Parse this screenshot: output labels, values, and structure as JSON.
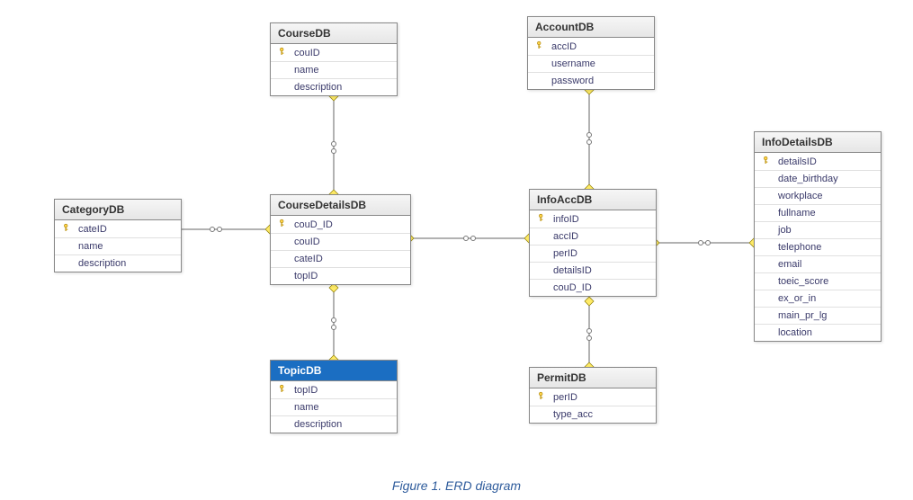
{
  "caption": "Figure 1. ERD diagram",
  "entities": [
    {
      "id": "CategoryDB",
      "title": "CategoryDB",
      "columns": [
        {
          "name": "cateID",
          "pk": true
        },
        {
          "name": "name"
        },
        {
          "name": "description"
        }
      ]
    },
    {
      "id": "CourseDB",
      "title": "CourseDB",
      "columns": [
        {
          "name": "couID",
          "pk": true
        },
        {
          "name": "name"
        },
        {
          "name": "description"
        }
      ]
    },
    {
      "id": "CourseDetailsDB",
      "title": "CourseDetailsDB",
      "columns": [
        {
          "name": "couD_ID",
          "pk": true
        },
        {
          "name": "couID"
        },
        {
          "name": "cateID"
        },
        {
          "name": "topID"
        }
      ]
    },
    {
      "id": "TopicDB",
      "title": "TopicDB",
      "selected": true,
      "columns": [
        {
          "name": "topID",
          "pk": true
        },
        {
          "name": "name"
        },
        {
          "name": "description"
        }
      ]
    },
    {
      "id": "AccountDB",
      "title": "AccountDB",
      "columns": [
        {
          "name": "accID",
          "pk": true
        },
        {
          "name": "username"
        },
        {
          "name": "password"
        }
      ]
    },
    {
      "id": "InfoAccDB",
      "title": "InfoAccDB",
      "columns": [
        {
          "name": "infoID",
          "pk": true
        },
        {
          "name": "accID"
        },
        {
          "name": "perID"
        },
        {
          "name": "detailsID"
        },
        {
          "name": "couD_ID"
        }
      ]
    },
    {
      "id": "PermitDB",
      "title": "PermitDB",
      "columns": [
        {
          "name": "perID",
          "pk": true
        },
        {
          "name": "type_acc"
        }
      ]
    },
    {
      "id": "InfoDetailsDB",
      "title": "InfoDetailsDB",
      "columns": [
        {
          "name": "detailsID",
          "pk": true
        },
        {
          "name": "date_birthday"
        },
        {
          "name": "workplace"
        },
        {
          "name": "fullname"
        },
        {
          "name": "job"
        },
        {
          "name": "telephone"
        },
        {
          "name": "email"
        },
        {
          "name": "toeic_score"
        },
        {
          "name": "ex_or_in"
        },
        {
          "name": "main_pr_lg"
        },
        {
          "name": "location"
        }
      ]
    }
  ],
  "relations": [
    {
      "from": "CourseDB",
      "to": "CourseDetailsDB"
    },
    {
      "from": "CategoryDB",
      "to": "CourseDetailsDB"
    },
    {
      "from": "TopicDB",
      "to": "CourseDetailsDB"
    },
    {
      "from": "CourseDetailsDB",
      "to": "InfoAccDB"
    },
    {
      "from": "AccountDB",
      "to": "InfoAccDB"
    },
    {
      "from": "PermitDB",
      "to": "InfoAccDB"
    },
    {
      "from": "InfoDetailsDB",
      "to": "InfoAccDB"
    }
  ]
}
